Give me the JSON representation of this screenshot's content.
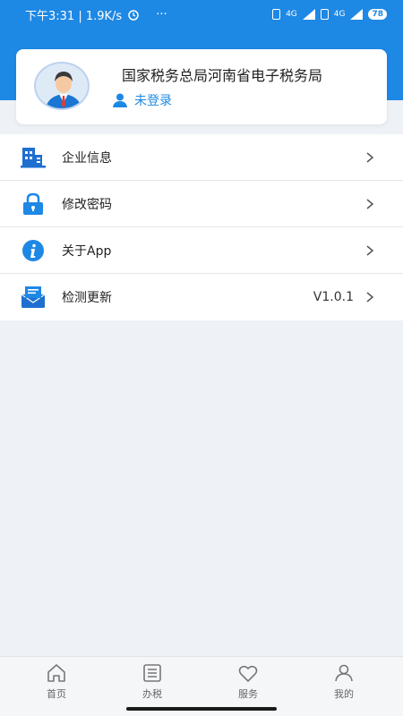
{
  "status_bar": {
    "time_speed": "下午3:31 | 1.9K/s",
    "more": "···",
    "net1": "4G",
    "net2": "4G",
    "battery": "78"
  },
  "profile": {
    "org_name": "国家税务总局河南省电子税务局",
    "login_status": "未登录"
  },
  "menu": {
    "items": [
      {
        "label": "企业信息",
        "icon": "building-icon",
        "value": ""
      },
      {
        "label": "修改密码",
        "icon": "lock-icon",
        "value": ""
      },
      {
        "label": "关于App",
        "icon": "info-icon",
        "value": ""
      },
      {
        "label": "检测更新",
        "icon": "mail-icon",
        "value": "V1.0.1"
      }
    ]
  },
  "tabbar": {
    "tabs": [
      {
        "label": "首页",
        "icon": "home-icon"
      },
      {
        "label": "办税",
        "icon": "list-icon"
      },
      {
        "label": "服务",
        "icon": "heart-icon"
      },
      {
        "label": "我的",
        "icon": "user-icon"
      }
    ]
  },
  "colors": {
    "primary": "#1e88e5",
    "background": "#eef1f5",
    "text": "#222222"
  }
}
